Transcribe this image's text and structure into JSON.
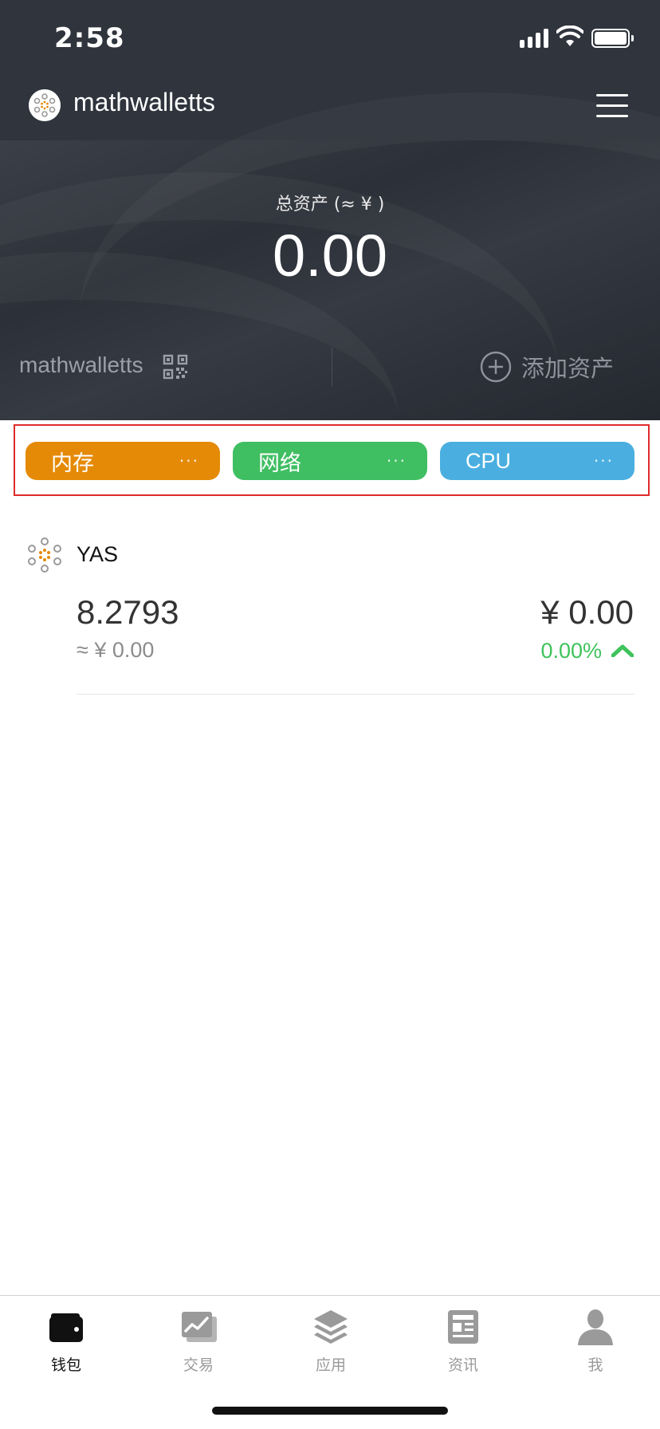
{
  "status_bar": {
    "time": "2:58"
  },
  "app_bar": {
    "title": "mathwalletts",
    "logo_icon": "mathwallet-logo-icon",
    "menu_icon": "hamburger-menu-icon"
  },
  "summary": {
    "total_label": "总资产 (≈ ¥ )",
    "total_value": "0.00",
    "account_name": "mathwalletts",
    "qr_icon": "qr-code-icon",
    "add_asset_label": "添加资产"
  },
  "resources": [
    {
      "label": "内存",
      "more": "···",
      "color": "#e58a06"
    },
    {
      "label": "网络",
      "more": "···",
      "color": "#3fbe62"
    },
    {
      "label": "CPU",
      "more": "···",
      "color": "#4aafe0"
    }
  ],
  "tokens": [
    {
      "name": "YAS",
      "amount": "8.2793",
      "cny_value": "≈ ¥ 0.00",
      "price": "¥ 0.00",
      "change": "0.00%",
      "change_color": "#3fc35c",
      "trend_icon": "arrow-up-icon"
    }
  ],
  "tab_bar": {
    "active": "钱包",
    "items": [
      {
        "label": "钱包",
        "icon": "wallet-icon"
      },
      {
        "label": "交易",
        "icon": "chart-icon"
      },
      {
        "label": "应用",
        "icon": "layers-icon"
      },
      {
        "label": "资讯",
        "icon": "news-icon"
      },
      {
        "label": "我",
        "icon": "user-icon"
      }
    ]
  }
}
